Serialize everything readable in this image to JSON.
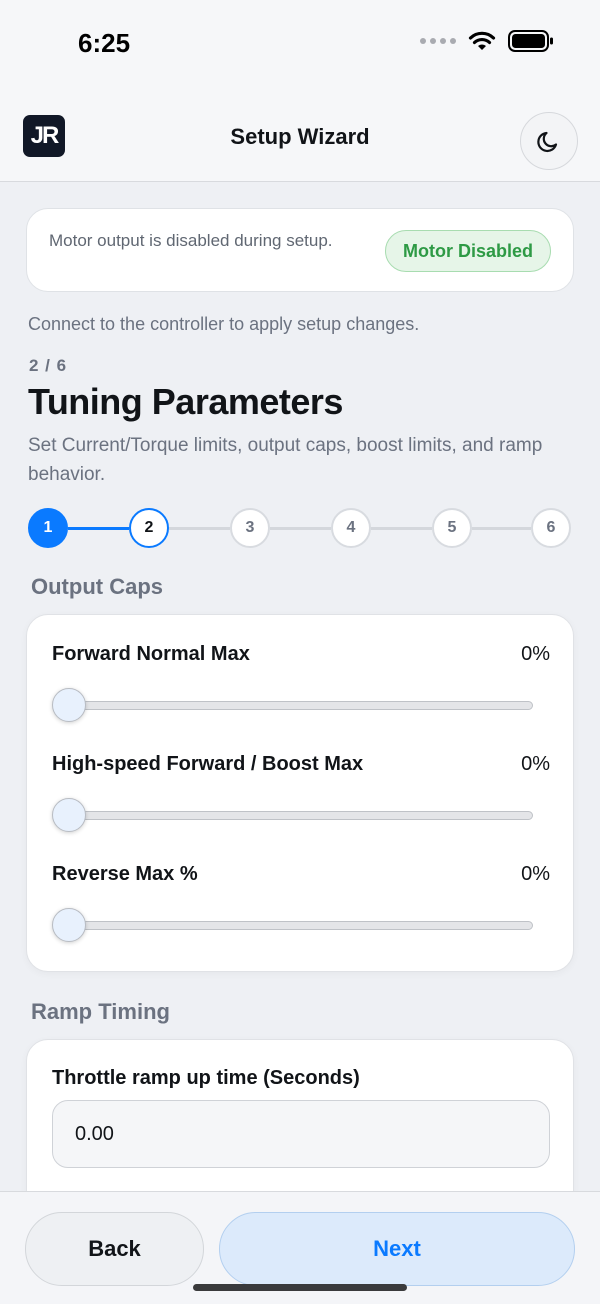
{
  "status_bar": {
    "time": "6:25"
  },
  "header": {
    "logo_text": "JR",
    "title": "Setup Wizard"
  },
  "notice": {
    "text": "Motor output is disabled during setup.",
    "badge": "Motor Disabled"
  },
  "connect_message": "Connect to the controller to apply setup changes.",
  "wizard": {
    "step_count": "2 / 6",
    "title": "Tuning Parameters",
    "description": "Set Current/Torque limits, output caps, boost limits, and ramp behavior.",
    "steps": [
      {
        "label": "1",
        "state": "done"
      },
      {
        "label": "2",
        "state": "current"
      },
      {
        "label": "3",
        "state": "upcoming"
      },
      {
        "label": "4",
        "state": "upcoming"
      },
      {
        "label": "5",
        "state": "upcoming"
      },
      {
        "label": "6",
        "state": "upcoming"
      }
    ]
  },
  "output_caps": {
    "section_title": "Output Caps",
    "sliders": [
      {
        "label": "Forward Normal Max",
        "value": "0%",
        "fraction": 0
      },
      {
        "label": "High-speed Forward / Boost Max",
        "value": "0%",
        "fraction": 0
      },
      {
        "label": "Reverse Max %",
        "value": "0%",
        "fraction": 0
      }
    ]
  },
  "ramp_timing": {
    "section_title": "Ramp Timing",
    "throttle_ramp_label": "Throttle ramp up time (Seconds)",
    "throttle_ramp_value": "0.00"
  },
  "footer": {
    "back_label": "Back",
    "next_label": "Next"
  },
  "colors": {
    "accent": "#0a7aff",
    "success": "#2e9a45",
    "background": "#eef0f4"
  },
  "icons": {
    "theme_toggle": "moon-icon",
    "signal": "cellular-dots-icon",
    "wifi": "wifi-icon",
    "battery": "battery-icon"
  }
}
